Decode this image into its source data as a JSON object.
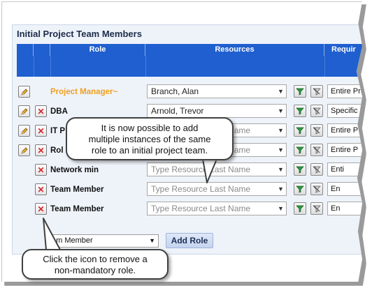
{
  "panel": {
    "title": "Initial Project Team Members"
  },
  "table": {
    "headers": [
      "Role",
      "Resources",
      "Requir"
    ]
  },
  "rows": [
    {
      "role": "Project Manager~",
      "resource": "Branch, Alan",
      "requirement": "Entire Pro",
      "deletable": false,
      "placeholder": false
    },
    {
      "role": "DBA",
      "resource": "Arnold, Trevor",
      "requirement": "Specific D",
      "deletable": true,
      "placeholder": false
    },
    {
      "role": "IT P",
      "resource": "Type Resource Last Name",
      "requirement": "Entire P",
      "deletable": true,
      "placeholder": true
    },
    {
      "role": "Rol",
      "resource": "Type Resource Last Name",
      "requirement": "Entire P",
      "deletable": true,
      "placeholder": true
    },
    {
      "role": "Network  min",
      "resource": "Type Resource Last Name",
      "requirement": "Enti",
      "deletable": true,
      "placeholder": true
    },
    {
      "role": "Team Member",
      "resource": "Type Resource Last Name",
      "requirement": "En",
      "deletable": true,
      "placeholder": true
    },
    {
      "role": "Team Member",
      "resource": "Type Resource Last Name",
      "requirement": "En",
      "deletable": true,
      "placeholder": true
    }
  ],
  "add_role": {
    "selected": "am Member",
    "button_label": "Add Role"
  },
  "callouts": {
    "top": [
      "It is now possible to add",
      "multiple instances of the same",
      "role to an initial project team."
    ],
    "bottom": [
      "Click the icon to remove a",
      "non-mandatory role."
    ]
  },
  "colors": {
    "header_blue": "#1f5fcf",
    "pm_orange": "#f0a020",
    "delete_red": "#d4262b",
    "filter_green": "#2a9a3a"
  },
  "icons": {
    "edit": "pencil-icon",
    "delete": "x-icon",
    "filter": "funnel-icon",
    "clear": "clear-filter-icon",
    "dropdown": "chevron-down-icon"
  }
}
